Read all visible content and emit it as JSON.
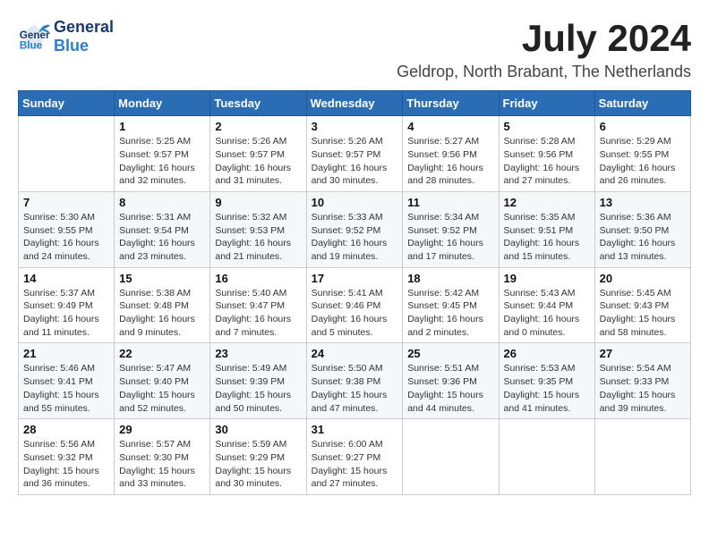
{
  "header": {
    "logo": {
      "line1": "General",
      "line2": "Blue"
    },
    "title": "July 2024",
    "location": "Geldrop, North Brabant, The Netherlands"
  },
  "calendar": {
    "weekdays": [
      "Sunday",
      "Monday",
      "Tuesday",
      "Wednesday",
      "Thursday",
      "Friday",
      "Saturday"
    ],
    "weeks": [
      [
        {
          "day": "",
          "info": ""
        },
        {
          "day": "1",
          "info": "Sunrise: 5:25 AM\nSunset: 9:57 PM\nDaylight: 16 hours\nand 32 minutes."
        },
        {
          "day": "2",
          "info": "Sunrise: 5:26 AM\nSunset: 9:57 PM\nDaylight: 16 hours\nand 31 minutes."
        },
        {
          "day": "3",
          "info": "Sunrise: 5:26 AM\nSunset: 9:57 PM\nDaylight: 16 hours\nand 30 minutes."
        },
        {
          "day": "4",
          "info": "Sunrise: 5:27 AM\nSunset: 9:56 PM\nDaylight: 16 hours\nand 28 minutes."
        },
        {
          "day": "5",
          "info": "Sunrise: 5:28 AM\nSunset: 9:56 PM\nDaylight: 16 hours\nand 27 minutes."
        },
        {
          "day": "6",
          "info": "Sunrise: 5:29 AM\nSunset: 9:55 PM\nDaylight: 16 hours\nand 26 minutes."
        }
      ],
      [
        {
          "day": "7",
          "info": "Sunrise: 5:30 AM\nSunset: 9:55 PM\nDaylight: 16 hours\nand 24 minutes."
        },
        {
          "day": "8",
          "info": "Sunrise: 5:31 AM\nSunset: 9:54 PM\nDaylight: 16 hours\nand 23 minutes."
        },
        {
          "day": "9",
          "info": "Sunrise: 5:32 AM\nSunset: 9:53 PM\nDaylight: 16 hours\nand 21 minutes."
        },
        {
          "day": "10",
          "info": "Sunrise: 5:33 AM\nSunset: 9:52 PM\nDaylight: 16 hours\nand 19 minutes."
        },
        {
          "day": "11",
          "info": "Sunrise: 5:34 AM\nSunset: 9:52 PM\nDaylight: 16 hours\nand 17 minutes."
        },
        {
          "day": "12",
          "info": "Sunrise: 5:35 AM\nSunset: 9:51 PM\nDaylight: 16 hours\nand 15 minutes."
        },
        {
          "day": "13",
          "info": "Sunrise: 5:36 AM\nSunset: 9:50 PM\nDaylight: 16 hours\nand 13 minutes."
        }
      ],
      [
        {
          "day": "14",
          "info": "Sunrise: 5:37 AM\nSunset: 9:49 PM\nDaylight: 16 hours\nand 11 minutes."
        },
        {
          "day": "15",
          "info": "Sunrise: 5:38 AM\nSunset: 9:48 PM\nDaylight: 16 hours\nand 9 minutes."
        },
        {
          "day": "16",
          "info": "Sunrise: 5:40 AM\nSunset: 9:47 PM\nDaylight: 16 hours\nand 7 minutes."
        },
        {
          "day": "17",
          "info": "Sunrise: 5:41 AM\nSunset: 9:46 PM\nDaylight: 16 hours\nand 5 minutes."
        },
        {
          "day": "18",
          "info": "Sunrise: 5:42 AM\nSunset: 9:45 PM\nDaylight: 16 hours\nand 2 minutes."
        },
        {
          "day": "19",
          "info": "Sunrise: 5:43 AM\nSunset: 9:44 PM\nDaylight: 16 hours\nand 0 minutes."
        },
        {
          "day": "20",
          "info": "Sunrise: 5:45 AM\nSunset: 9:43 PM\nDaylight: 15 hours\nand 58 minutes."
        }
      ],
      [
        {
          "day": "21",
          "info": "Sunrise: 5:46 AM\nSunset: 9:41 PM\nDaylight: 15 hours\nand 55 minutes."
        },
        {
          "day": "22",
          "info": "Sunrise: 5:47 AM\nSunset: 9:40 PM\nDaylight: 15 hours\nand 52 minutes."
        },
        {
          "day": "23",
          "info": "Sunrise: 5:49 AM\nSunset: 9:39 PM\nDaylight: 15 hours\nand 50 minutes."
        },
        {
          "day": "24",
          "info": "Sunrise: 5:50 AM\nSunset: 9:38 PM\nDaylight: 15 hours\nand 47 minutes."
        },
        {
          "day": "25",
          "info": "Sunrise: 5:51 AM\nSunset: 9:36 PM\nDaylight: 15 hours\nand 44 minutes."
        },
        {
          "day": "26",
          "info": "Sunrise: 5:53 AM\nSunset: 9:35 PM\nDaylight: 15 hours\nand 41 minutes."
        },
        {
          "day": "27",
          "info": "Sunrise: 5:54 AM\nSunset: 9:33 PM\nDaylight: 15 hours\nand 39 minutes."
        }
      ],
      [
        {
          "day": "28",
          "info": "Sunrise: 5:56 AM\nSunset: 9:32 PM\nDaylight: 15 hours\nand 36 minutes."
        },
        {
          "day": "29",
          "info": "Sunrise: 5:57 AM\nSunset: 9:30 PM\nDaylight: 15 hours\nand 33 minutes."
        },
        {
          "day": "30",
          "info": "Sunrise: 5:59 AM\nSunset: 9:29 PM\nDaylight: 15 hours\nand 30 minutes."
        },
        {
          "day": "31",
          "info": "Sunrise: 6:00 AM\nSunset: 9:27 PM\nDaylight: 15 hours\nand 27 minutes."
        },
        {
          "day": "",
          "info": ""
        },
        {
          "day": "",
          "info": ""
        },
        {
          "day": "",
          "info": ""
        }
      ]
    ]
  }
}
